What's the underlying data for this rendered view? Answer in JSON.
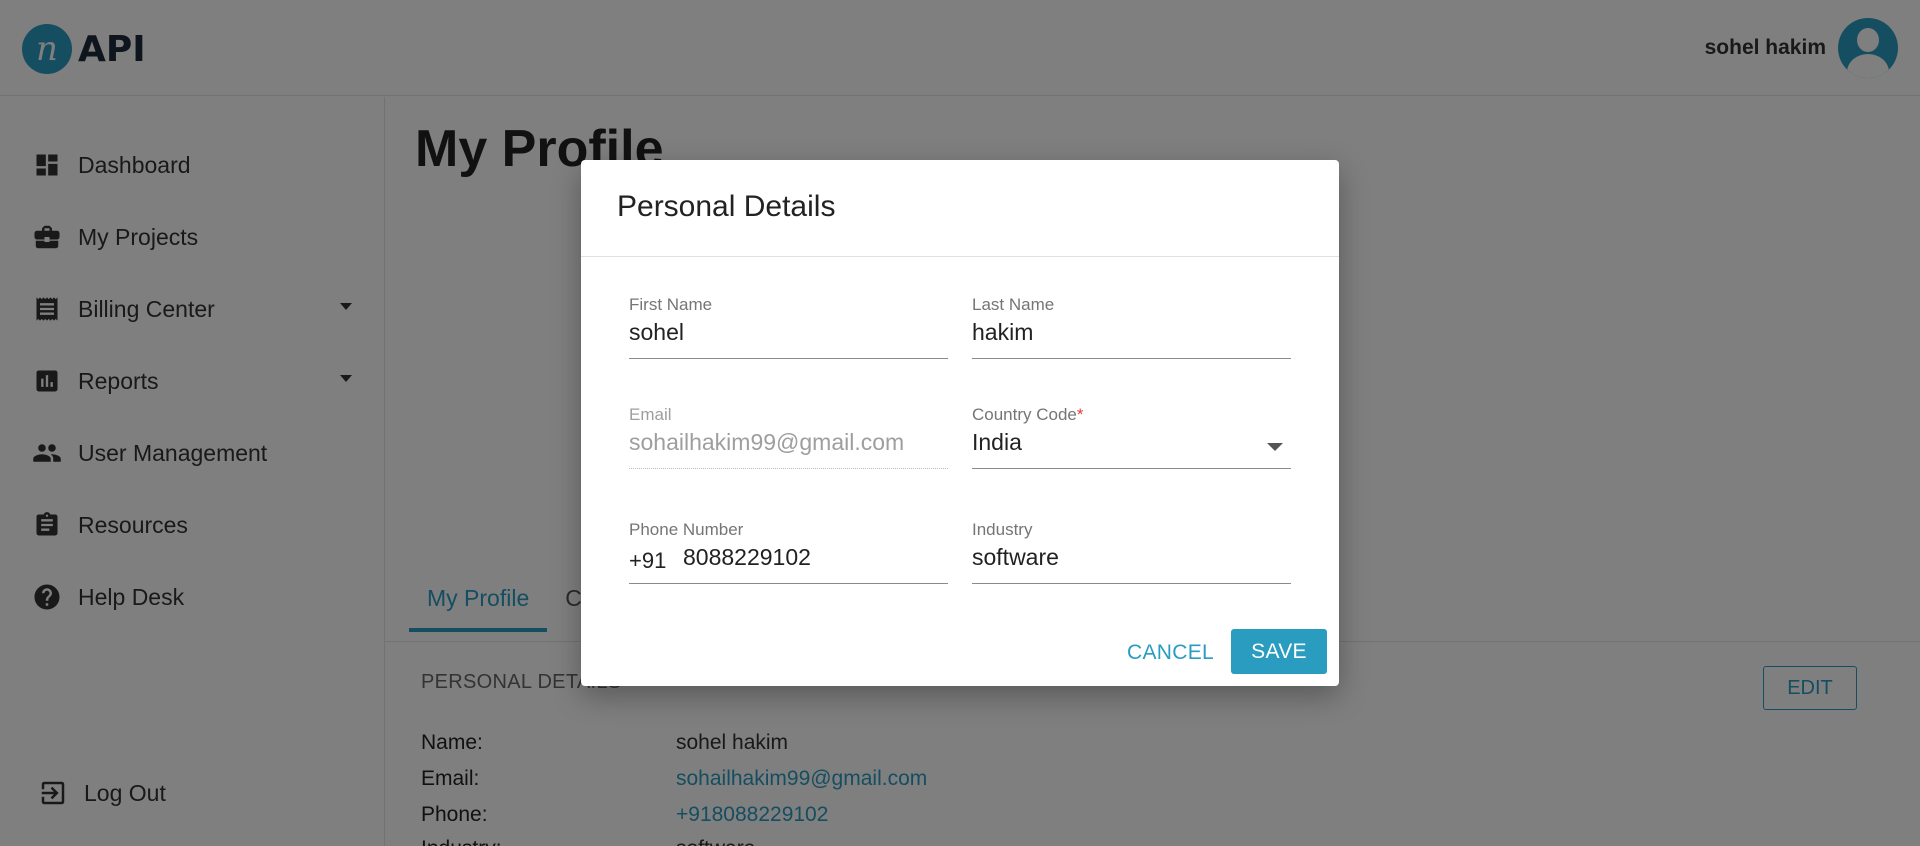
{
  "header": {
    "logo_mark": "n",
    "logo_text": "API",
    "user_name": "sohel hakim"
  },
  "sidebar": {
    "items": [
      {
        "label": "Dashboard",
        "icon": "dashboard-icon"
      },
      {
        "label": "My Projects",
        "icon": "briefcase-icon"
      },
      {
        "label": "Billing Center",
        "icon": "receipt-icon",
        "expandable": true
      },
      {
        "label": "Reports",
        "icon": "bar-chart-icon",
        "expandable": true
      },
      {
        "label": "User Management",
        "icon": "people-icon"
      },
      {
        "label": "Resources",
        "icon": "clipboard-icon"
      },
      {
        "label": "Help Desk",
        "icon": "help-circle-icon"
      }
    ],
    "logout_label": "Log Out"
  },
  "main": {
    "page_title": "My Profile",
    "tabs": [
      {
        "label": "My Profile",
        "active": true
      },
      {
        "label": "C",
        "active": false
      }
    ],
    "section_title": "PERSONAL DETAILS",
    "edit_label": "EDIT",
    "details": [
      {
        "label": "Name:",
        "value": "sohel hakim"
      },
      {
        "label": "Email:",
        "value": "sohailhakim99@gmail.com"
      },
      {
        "label": "Phone:",
        "value": "+918088229102"
      },
      {
        "label": "Industry:",
        "value": "software"
      }
    ]
  },
  "modal": {
    "title": "Personal Details",
    "fields": {
      "first_name": {
        "label": "First Name",
        "value": "sohel"
      },
      "last_name": {
        "label": "Last Name",
        "value": "hakim"
      },
      "email": {
        "label": "Email",
        "value": "sohailhakim99@gmail.com",
        "disabled": true
      },
      "country_code": {
        "label": "Country Code",
        "required_mark": "*",
        "value": "India"
      },
      "phone": {
        "label": "Phone Number",
        "prefix": "+91",
        "value": "8088229102"
      },
      "industry": {
        "label": "Industry",
        "value": "software"
      }
    },
    "cancel_label": "CANCEL",
    "save_label": "SAVE"
  },
  "colors": {
    "accent": "#2a9cc0",
    "overlay": "rgba(0,0,0,0.5)",
    "required": "#e53935"
  }
}
